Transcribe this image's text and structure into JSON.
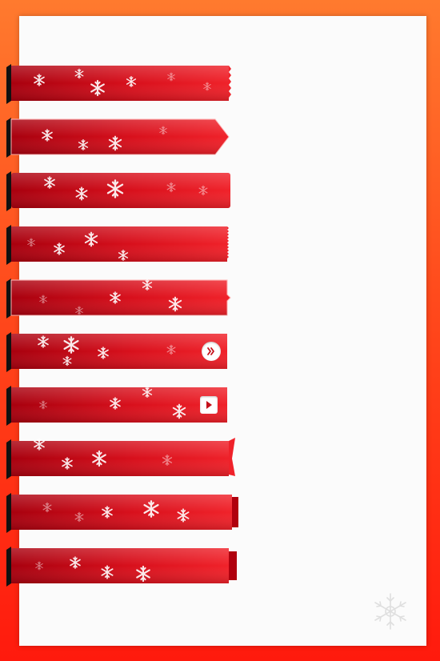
{
  "theme": {
    "background_top": "#ff7a2e",
    "background_bottom": "#ff1a0d",
    "paper": "#fbfbfb",
    "ribbon_dark": "#b3000f",
    "ribbon_light": "#ee1b24",
    "snow": "#ffffff"
  },
  "ribbons": [
    {
      "end": "jagged",
      "button": null
    },
    {
      "end": "arrow",
      "button": null
    },
    {
      "end": "rounded",
      "button": null
    },
    {
      "end": "serrated",
      "button": null
    },
    {
      "end": "notch",
      "button": null
    },
    {
      "end": "flat",
      "button": "double-chevron-right-icon"
    },
    {
      "end": "flat",
      "button": "play-icon"
    },
    {
      "end": "fold",
      "button": null
    },
    {
      "end": "tab",
      "button": null
    },
    {
      "end": "tab-small",
      "button": null
    }
  ],
  "decoration": {
    "icon": "snowflake-icon"
  }
}
